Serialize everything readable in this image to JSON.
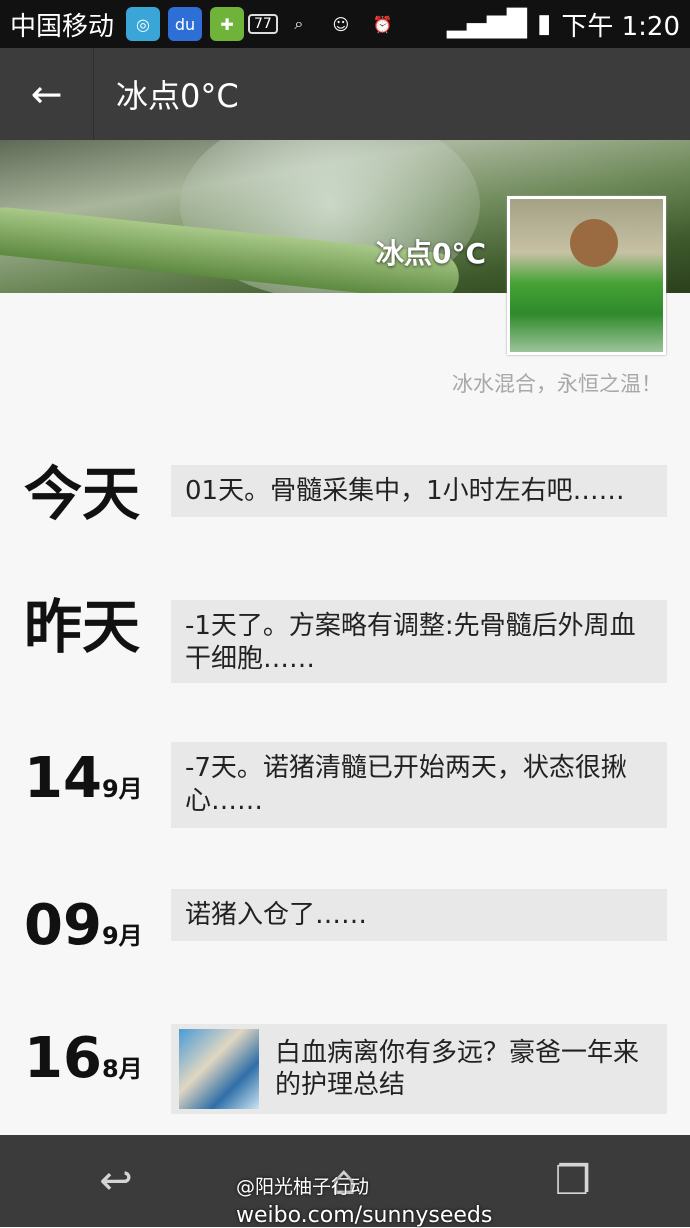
{
  "status_bar": {
    "carrier": "中国移动",
    "notification_badge": "77",
    "time": "下午 1:20"
  },
  "header": {
    "title": "冰点0°C"
  },
  "profile": {
    "cover_name": "冰点0°C",
    "signature": "冰水混合，永恒之温！"
  },
  "entries": [
    {
      "date_label": "今天",
      "text": "01天。骨髓采集中，1小时左右吧……"
    },
    {
      "date_label": "昨天",
      "text": "-1天了。方案略有调整:先骨髓后外周血干细胞……"
    },
    {
      "day": "14",
      "month": "9月",
      "text": "-7天。诺猪清髓已开始两天，状态很揪心……"
    },
    {
      "day": "09",
      "month": "9月",
      "text": "诺猪入仓了……"
    },
    {
      "day": "16",
      "month": "8月",
      "text": "白血病离你有多远？豪爸一年来的护理总结"
    }
  ],
  "watermark": {
    "line1": "@阳光柚子行动",
    "line2": "weibo.com/sunnyseeds"
  }
}
